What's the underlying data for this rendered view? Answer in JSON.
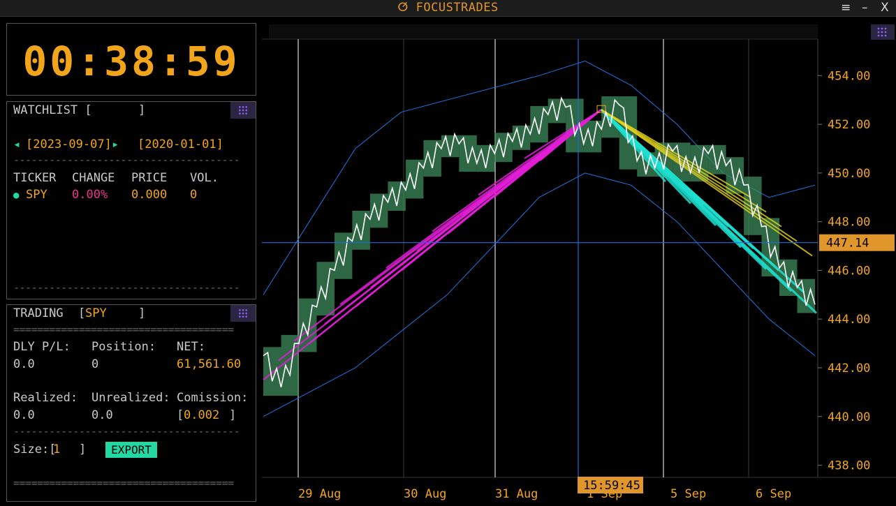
{
  "app": {
    "title": "FOCUSTRADES",
    "logo_icon": "link-ring-icon",
    "menu_icon": "≡",
    "minimize_icon": "–",
    "close_icon": "X"
  },
  "clock": {
    "time": "00:38:59"
  },
  "watchlist": {
    "title": "WATCHLIST [",
    "title_close": "]",
    "date_prev": "◂",
    "date_start": "[2023-09-07]",
    "date_next": "▸",
    "date_end": "[2020-01-01]",
    "separator": "--------------------------------------",
    "columns": [
      "TICKER",
      "CHANGE",
      "PRICE",
      "VOL."
    ],
    "rows": [
      {
        "dot": "●",
        "ticker": "SPY",
        "change": "0.00%",
        "price": "0.000",
        "vol": "0"
      }
    ]
  },
  "trading": {
    "title": "TRADING",
    "ticker_open": "[",
    "ticker": "SPY",
    "ticker_close": "]",
    "separator": "=====================================",
    "dash_separator": "--------------------------------------",
    "labels": {
      "dly_pl": "DLY P/L:",
      "position": "Position:",
      "net": "NET:",
      "realized": "Realized:",
      "unrealized": "Unrealized:",
      "commission": "Comission:",
      "size": "Size:["
    },
    "values": {
      "dly_pl": "0.0",
      "position": "0",
      "net": "61,561.60",
      "realized": "0.0",
      "unrealized": "0.0",
      "commission_open": "[",
      "commission": "0.002",
      "commission_close": "]",
      "size": "1",
      "size_close": "]"
    },
    "export_label": "EXPORT"
  },
  "chart_data": {
    "type": "candlestick",
    "price_axis": [
      "454.00",
      "452.00",
      "450.00",
      "448.00",
      "446.00",
      "444.00",
      "442.00",
      "440.00",
      "438.00"
    ],
    "ylim": [
      437.5,
      455.5
    ],
    "date_labels": [
      "29 Aug",
      "30 Aug",
      "31 Aug",
      "1 Sep",
      "5 Sep",
      "6 Sep"
    ],
    "crosshair_price": "447.14",
    "crosshair_time": "15:59:45",
    "series": [
      {
        "name": "close",
        "color": "#ffffff",
        "values": [
          442.5,
          441.2,
          443.0,
          444.5,
          446.0,
          447.2,
          448.1,
          448.8,
          449.3,
          450.2,
          451.0,
          451.2,
          450.4,
          450.8,
          451.3,
          451.6,
          452.4,
          452.7,
          451.2,
          451.8,
          452.8,
          450.5,
          450.2,
          450.9,
          450.0,
          450.8,
          450.3,
          449.5,
          447.8,
          446.1,
          445.3,
          444.6
        ]
      },
      {
        "name": "upper_band",
        "color": "#1f74e0",
        "values": [
          445.0,
          448.0,
          451.0,
          452.5,
          453.0,
          453.5,
          454.0,
          454.6,
          453.6,
          452.0,
          450.0,
          449.0,
          449.5
        ]
      },
      {
        "name": "lower_band",
        "color": "#1f74e0",
        "values": [
          440.0,
          441.0,
          442.0,
          443.5,
          445.0,
          447.0,
          449.0,
          450.0,
          449.5,
          448.0,
          446.0,
          444.0,
          442.5
        ]
      }
    ]
  }
}
